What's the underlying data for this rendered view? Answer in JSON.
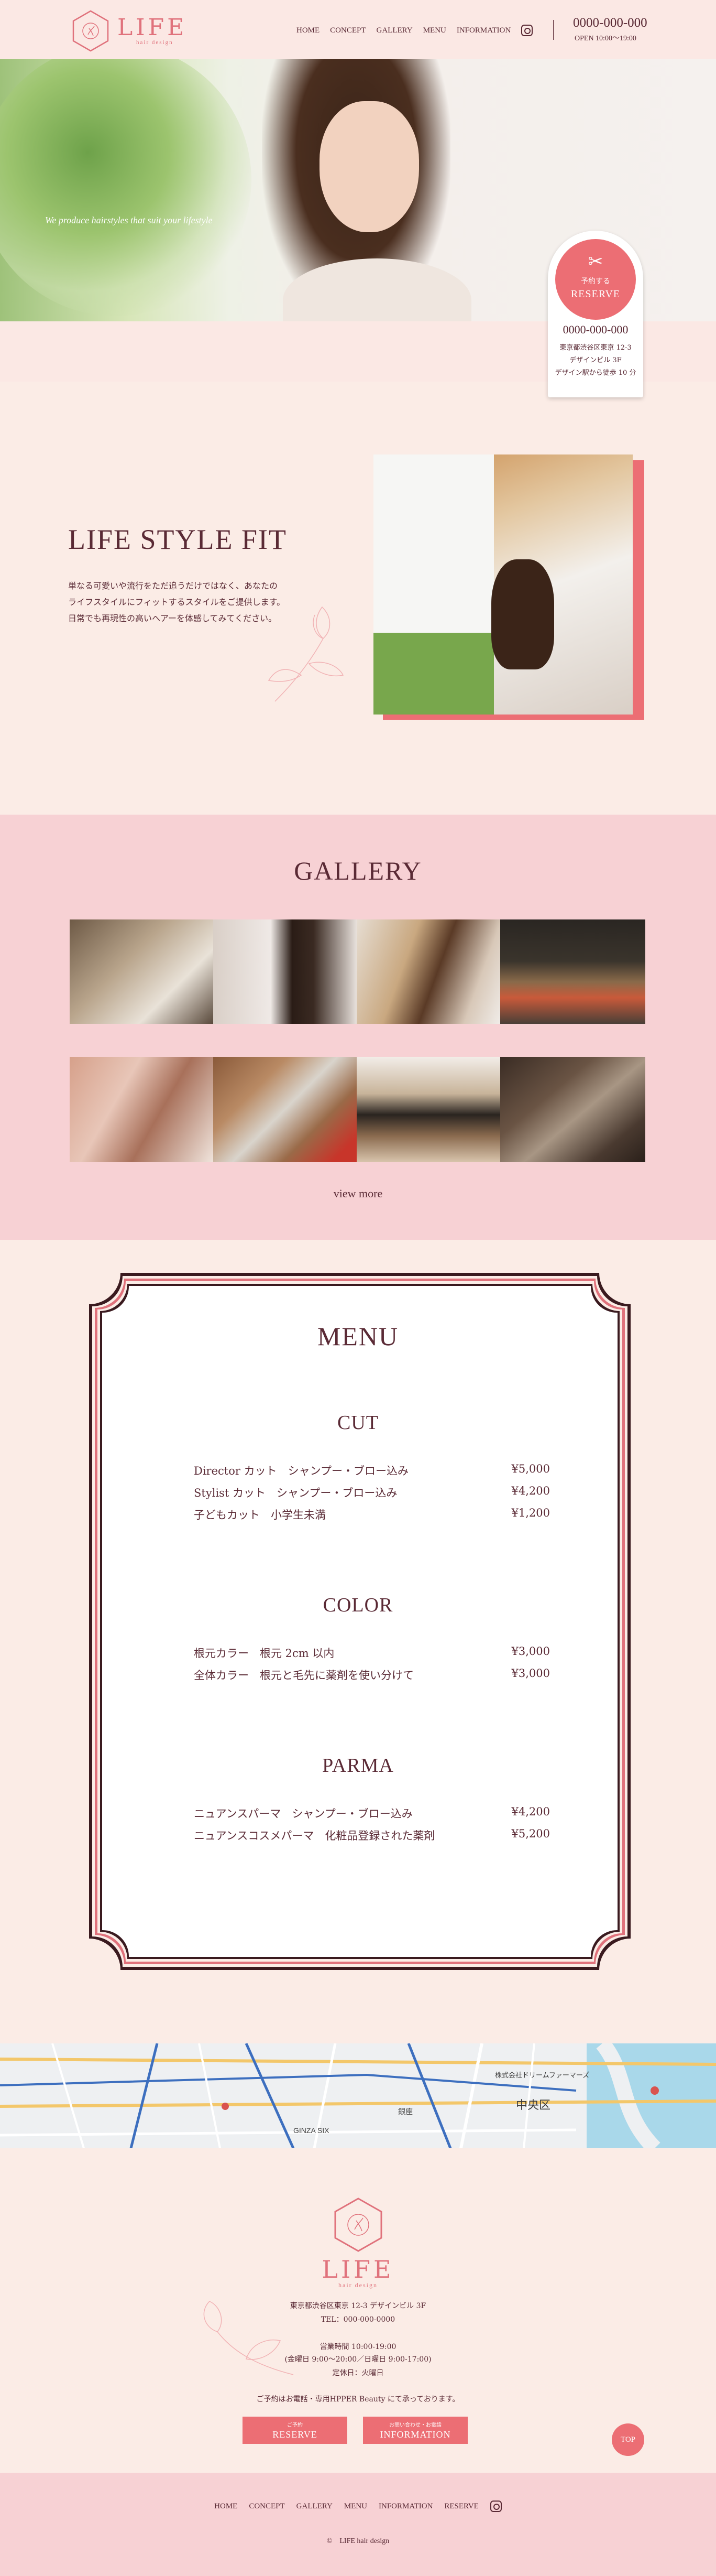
{
  "brand": {
    "name": "LIFE",
    "sub": "hair design"
  },
  "header": {
    "nav": [
      "HOME",
      "CONCEPT",
      "GALLERY",
      "MENU",
      "INFORMATION"
    ],
    "tel": "0000-000-000",
    "open": "OPEN 10:00〜19:00"
  },
  "hero": {
    "tagline": "We produce hairstyles that suit your lifestyle"
  },
  "reserve_card": {
    "small": "予約する",
    "big": "RESERVE",
    "tel": "0000-000-000",
    "address_lines": [
      "東京都渋谷区東京 12-3",
      "デザインビル 3F",
      "デザイン駅から徒歩 10 分"
    ]
  },
  "concept": {
    "title": "LIFE STYLE FIT",
    "lines": [
      "単なる可愛いや流行をただ追うだけではなく、あなたの",
      "ライフスタイルにフィットするスタイルをご提供します。",
      "日常でも再現性の高いヘアーを体感してみてください。"
    ]
  },
  "gallery": {
    "title": "GALLERY",
    "view_more": "view more"
  },
  "menu": {
    "title": "MENU",
    "categories": [
      {
        "name": "CUT",
        "items": [
          {
            "name": "Director カット　シャンプー・ブロー込み",
            "price": "¥5,000"
          },
          {
            "name": "Stylist カット　シャンプー・ブロー込み",
            "price": "¥4,200"
          },
          {
            "name": "子どもカット　小学生未満",
            "price": "¥1,200"
          }
        ]
      },
      {
        "name": "COLOR",
        "items": [
          {
            "name": "根元カラー　根元 2cm 以内",
            "price": "¥3,000"
          },
          {
            "name": "全体カラー　根元と毛先に薬剤を使い分けて",
            "price": "¥3,000"
          }
        ]
      },
      {
        "name": "PARMA",
        "items": [
          {
            "name": "ニュアンスパーマ　シャンプー・ブロー込み",
            "price": "¥4,200"
          },
          {
            "name": "ニュアンスコスメパーマ　化粧品登録された薬剤",
            "price": "¥5,200"
          }
        ]
      }
    ]
  },
  "map": {
    "labels": [
      "GINZA SIX",
      "中央区",
      "株式会社ドリームファーマーズ",
      "銀座"
    ]
  },
  "footer": {
    "address": "東京都渋谷区東京 12-3 デザインビル 3F",
    "tel": "TEL：000-000-0000",
    "hours_title": "営業時間 10:00-19:00",
    "hours": "(金曜日 9:00〜20:00／日曜日 9:00-17:00)",
    "closed": "定休日：火曜日",
    "notice": "ご予約はお電話・専用HPPER Beauty にて承っております。",
    "btn_reserve_small": "ご予約",
    "btn_reserve": "RESERVE",
    "btn_info_small": "お問い合わせ・お電話",
    "btn_info": "INFORMATION",
    "top": "TOP",
    "nav": [
      "HOME",
      "CONCEPT",
      "GALLERY",
      "MENU",
      "INFORMATION",
      "RESERVE"
    ],
    "copyright": "©　LIFE hair design"
  },
  "colors": {
    "accent": "#ec6e74",
    "text": "#5a2a35",
    "pink_bg": "#f7d1d4",
    "cream_bg": "#fbece6"
  }
}
